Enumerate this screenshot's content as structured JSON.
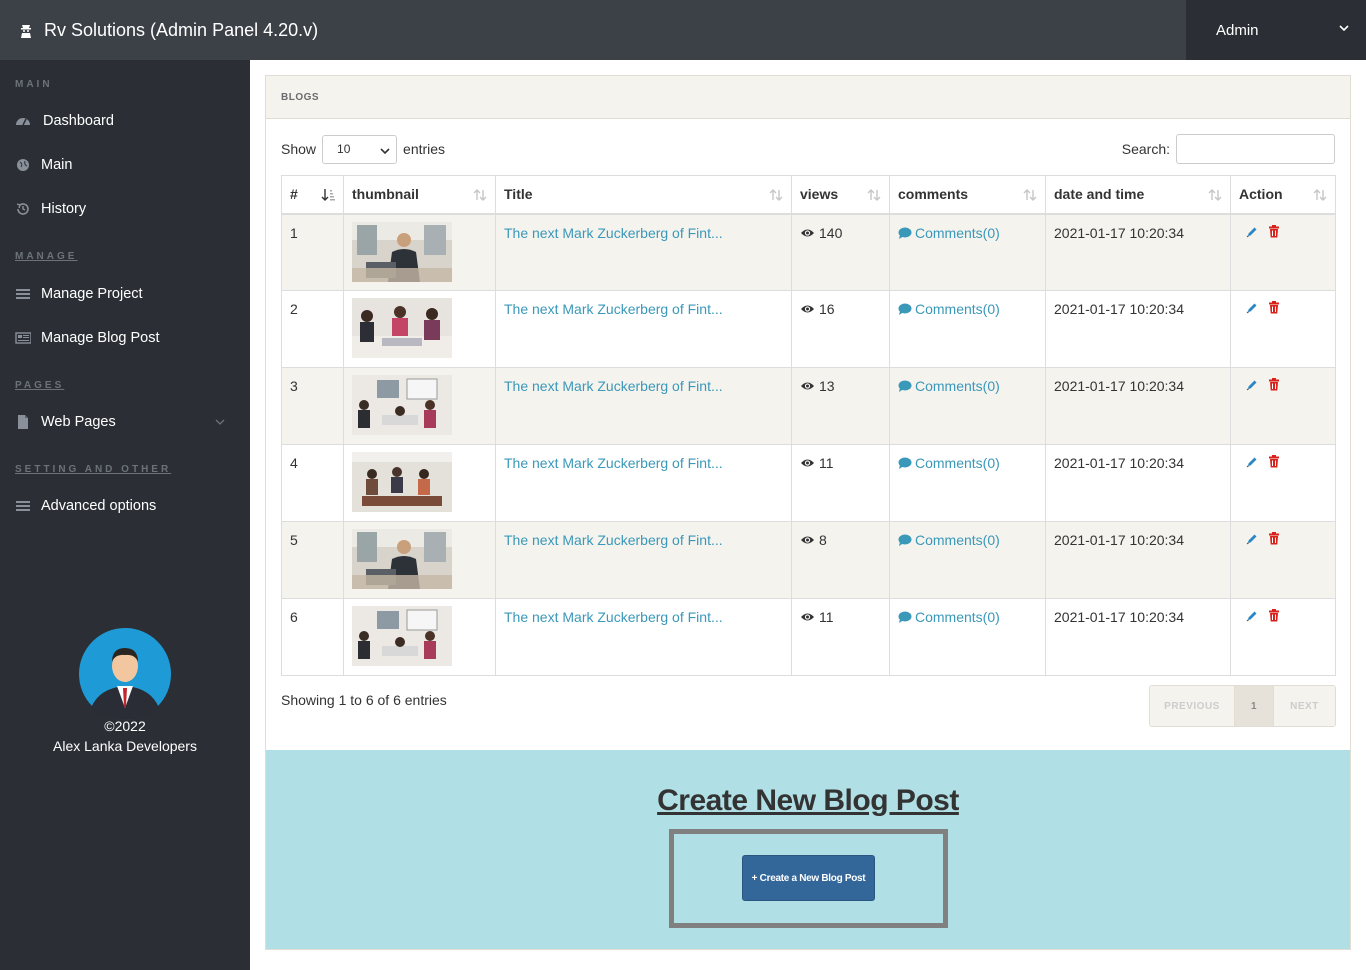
{
  "app": {
    "title": "Rv Solutions (Admin Panel 4.20.v)",
    "user": "Admin"
  },
  "sidebar": {
    "sections": {
      "main": "MAIN",
      "manage": "MANAGE",
      "pages": "PAGES",
      "settings": "SETTING AND OTHER"
    },
    "items": {
      "dashboard": "Dashboard",
      "main": "Main",
      "history": "History",
      "manage_project": "Manage Project",
      "manage_blog": "Manage Blog Post",
      "web_pages": "Web Pages",
      "advanced": "Advanced options"
    },
    "footer": {
      "year": "©2022",
      "org": "Alex Lanka Developers"
    }
  },
  "panel": {
    "heading": "BLOGS",
    "show_label": "Show",
    "entries_value": "10",
    "entries_label": "entries",
    "search_label": "Search:",
    "search_value": ""
  },
  "table": {
    "columns": {
      "num": "#",
      "thumbnail": "thumbnail",
      "title": "Title",
      "views": "views",
      "comments": "comments",
      "date": "date and time",
      "action": "Action"
    },
    "rows": [
      {
        "num": "1",
        "title": "The next Mark Zuckerberg of Fint...",
        "views": "140",
        "comments": "Comments(0)",
        "date": "2021-01-17 10:20:34"
      },
      {
        "num": "2",
        "title": "The next Mark Zuckerberg of Fint...",
        "views": "16",
        "comments": "Comments(0)",
        "date": "2021-01-17 10:20:34"
      },
      {
        "num": "3",
        "title": "The next Mark Zuckerberg of Fint...",
        "views": "13",
        "comments": "Comments(0)",
        "date": "2021-01-17 10:20:34"
      },
      {
        "num": "4",
        "title": "The next Mark Zuckerberg of Fint...",
        "views": "11",
        "comments": "Comments(0)",
        "date": "2021-01-17 10:20:34"
      },
      {
        "num": "5",
        "title": "The next Mark Zuckerberg of Fint...",
        "views": "8",
        "comments": "Comments(0)",
        "date": "2021-01-17 10:20:34"
      },
      {
        "num": "6",
        "title": "The next Mark Zuckerberg of Fint...",
        "views": "11",
        "comments": "Comments(0)",
        "date": "2021-01-17 10:20:34"
      }
    ]
  },
  "pagination": {
    "info": "Showing 1 to 6 of 6 entries",
    "previous": "PREVIOUS",
    "current": "1",
    "next": "NEXT"
  },
  "cta": {
    "title": "Create New Blog Post",
    "button": "+ Create a New Blog Post"
  },
  "colors": {
    "topbar": "#3c4148",
    "sidebar": "#2b2f35",
    "link": "#3a98b9",
    "cta_bg": "#b0dfe5",
    "cta_button": "#336699",
    "delete": "#d9211c"
  }
}
